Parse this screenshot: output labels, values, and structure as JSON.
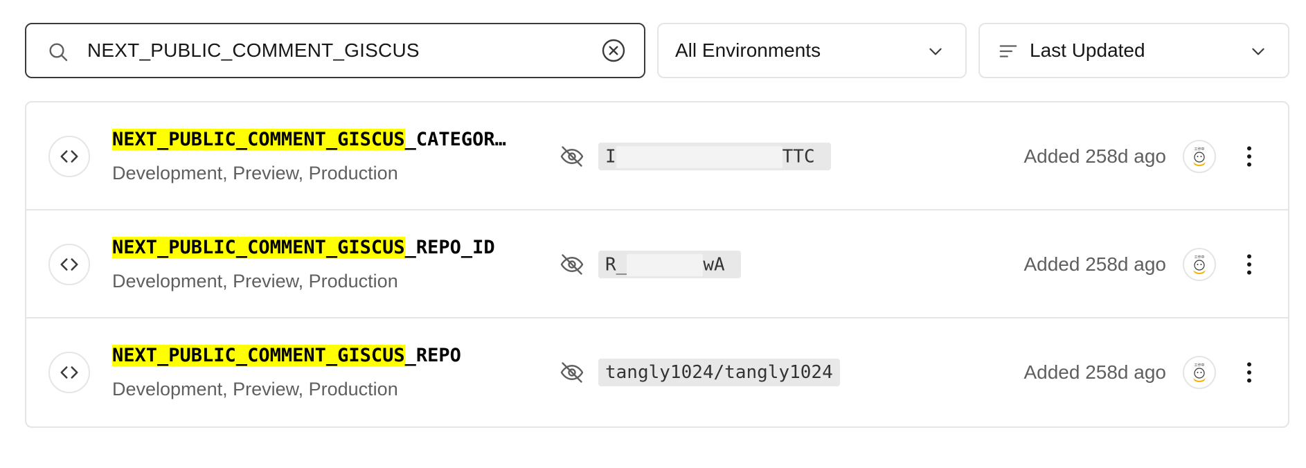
{
  "search": {
    "value": "NEXT_PUBLIC_COMMENT_GISCUS",
    "icon": "search-icon",
    "clear_icon": "clear-icon"
  },
  "env_filter": {
    "selected": "All Environments",
    "icon": "chevron-down-icon"
  },
  "sort": {
    "selected": "Last Updated",
    "icon": "sort-lines-icon"
  },
  "highlight_color": "#ffff00",
  "variables": [
    {
      "name_highlight": "NEXT_PUBLIC_COMMENT_GISCUS",
      "name_rest": "_CATEGOR…",
      "environments": "Development, Preview, Production",
      "value_start": "I",
      "value_end": "TTC",
      "added": "Added 258d ago"
    },
    {
      "name_highlight": "NEXT_PUBLIC_COMMENT_GISCUS",
      "name_rest": "_REPO_ID",
      "environments": "Development, Preview, Production",
      "value_start": "R_",
      "value_end": "wA",
      "added": "Added 258d ago"
    },
    {
      "name_highlight": "NEXT_PUBLIC_COMMENT_GISCUS",
      "name_rest": "_REPO",
      "environments": "Development, Preview, Production",
      "value_full": "tangly1024/tangly1024",
      "added": "Added 258d ago"
    }
  ]
}
